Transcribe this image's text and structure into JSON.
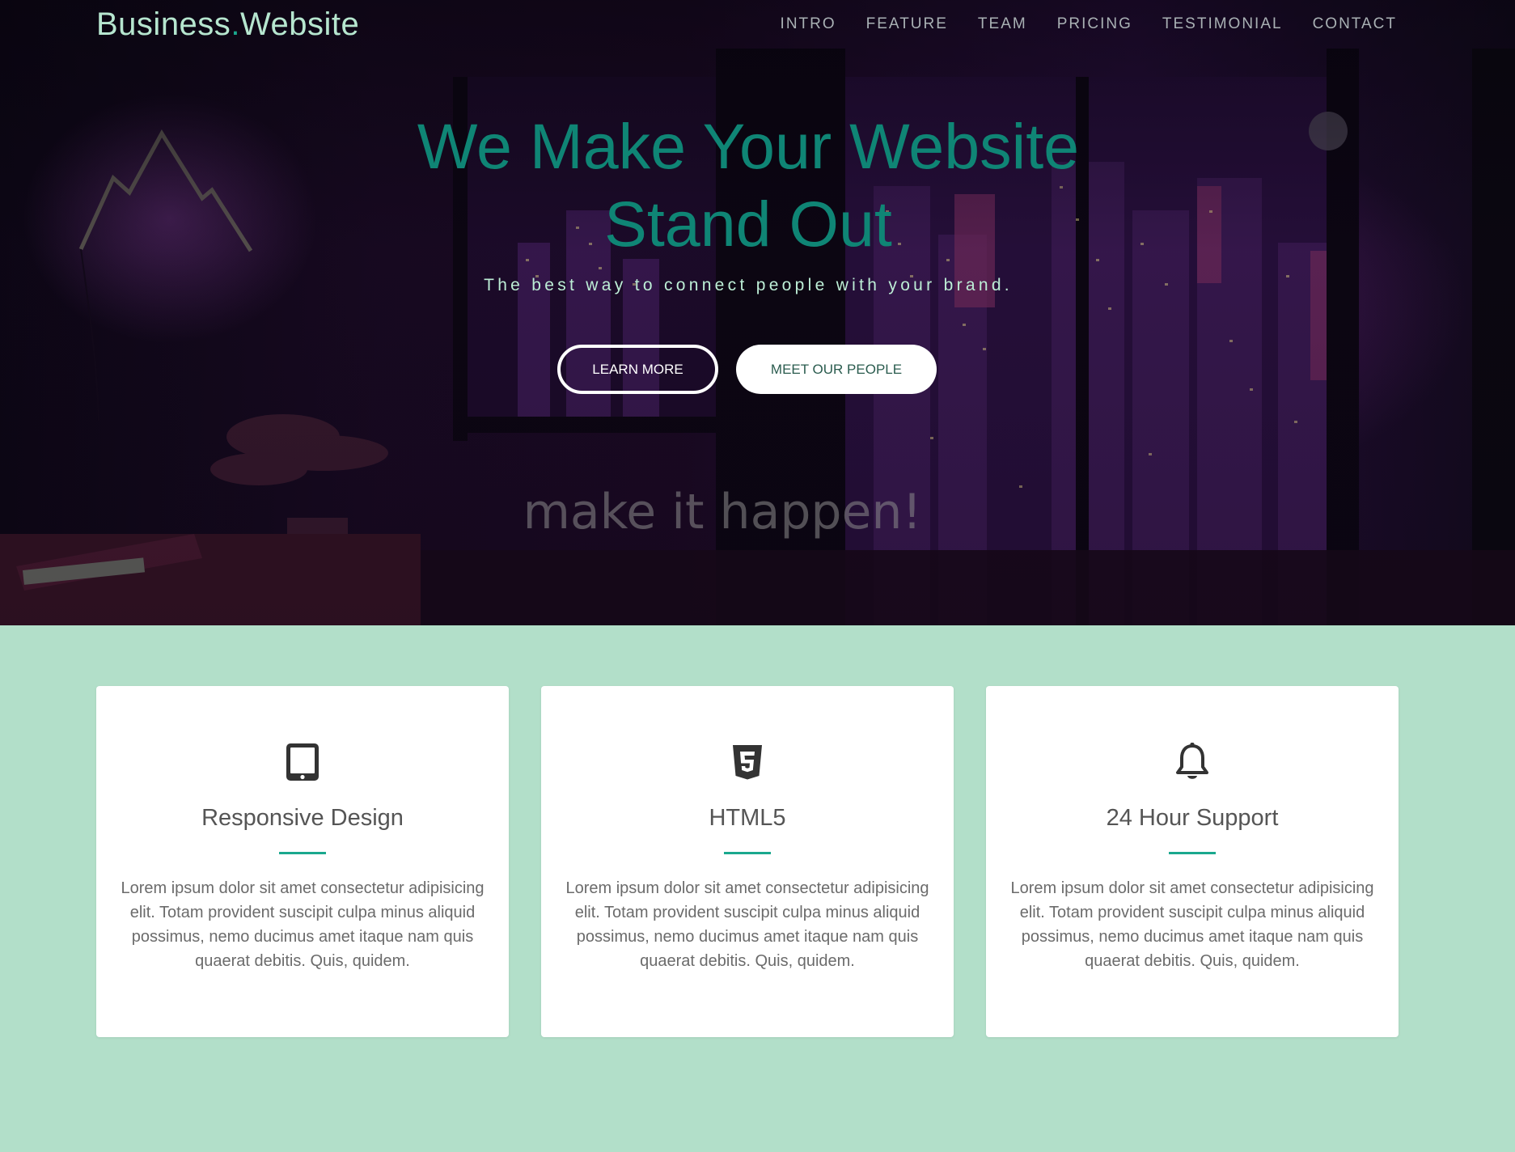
{
  "brand": {
    "name": "Business",
    "dot": ".",
    "suffix": "Website"
  },
  "nav": {
    "items": [
      {
        "label": "INTRO"
      },
      {
        "label": "FEATURE"
      },
      {
        "label": "TEAM"
      },
      {
        "label": "PRICING"
      },
      {
        "label": "TESTIMONIAL"
      },
      {
        "label": "CONTACT"
      }
    ]
  },
  "hero": {
    "title_line1": "We Make Your Website",
    "title_line2": "Stand Out",
    "subtitle": "The best way to connect people with your brand.",
    "primary_button": "LEARN MORE",
    "secondary_button": "MEET OUR PEOPLE",
    "background_text": "make it happen!"
  },
  "features": {
    "cards": [
      {
        "icon": "tablet-icon",
        "title": "Responsive Design",
        "text": "Lorem ipsum dolor sit amet consectetur adipisicing elit. Totam provident suscipit culpa minus aliquid possimus, nemo ducimus amet itaque nam quis quaerat debitis. Quis, quidem."
      },
      {
        "icon": "html5-icon",
        "title": "HTML5",
        "text": "Lorem ipsum dolor sit amet consectetur adipisicing elit. Totam provident suscipit culpa minus aliquid possimus, nemo ducimus amet itaque nam quis quaerat debitis. Quis, quidem."
      },
      {
        "icon": "bell-icon",
        "title": "24 Hour Support",
        "text": "Lorem ipsum dolor sit amet consectetur adipisicing elit. Totam provident suscipit culpa minus aliquid possimus, nemo ducimus amet itaque nam quis quaerat debitis. Quis, quidem."
      }
    ]
  },
  "colors": {
    "accent": "#1aa88e",
    "hero_title": "#0f8575",
    "brand_text": "#b6e6cf",
    "features_bg": "#b2dfc9"
  }
}
